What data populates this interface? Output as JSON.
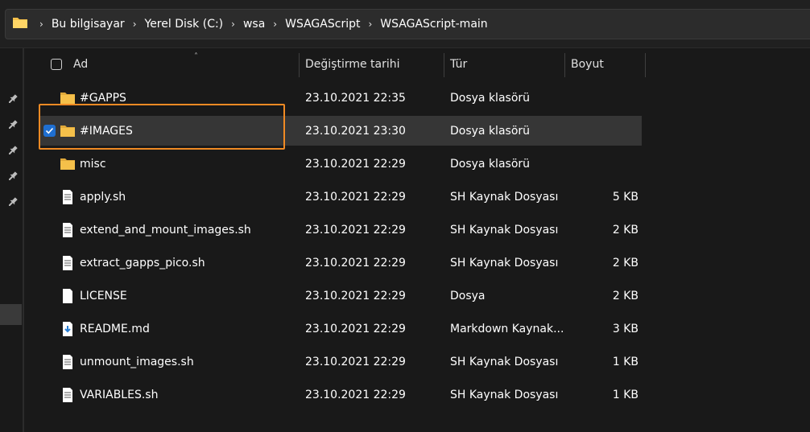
{
  "addressbar": {
    "breadcrumbs": [
      "Bu bilgisayar",
      "Yerel Disk (C:)",
      "wsa",
      "WSAGAScript",
      "WSAGAScript-main"
    ]
  },
  "columns": {
    "name": "Ad",
    "date": "Değiştirme tarihi",
    "type": "Tür",
    "size": "Boyut"
  },
  "files": [
    {
      "name": "#GAPPS",
      "date": "23.10.2021 22:35",
      "type": "Dosya klasörü",
      "size": "",
      "icon": "folder-icon"
    },
    {
      "name": "#IMAGES",
      "date": "23.10.2021 23:30",
      "type": "Dosya klasörü",
      "size": "",
      "icon": "folder-icon",
      "selected": true
    },
    {
      "name": "misc",
      "date": "23.10.2021 22:29",
      "type": "Dosya klasörü",
      "size": "",
      "icon": "folder-icon"
    },
    {
      "name": "apply.sh",
      "date": "23.10.2021 22:29",
      "type": "SH Kaynak Dosyası",
      "size": "5 KB",
      "icon": "text-file-icon"
    },
    {
      "name": "extend_and_mount_images.sh",
      "date": "23.10.2021 22:29",
      "type": "SH Kaynak Dosyası",
      "size": "2 KB",
      "icon": "text-file-icon"
    },
    {
      "name": "extract_gapps_pico.sh",
      "date": "23.10.2021 22:29",
      "type": "SH Kaynak Dosyası",
      "size": "2 KB",
      "icon": "text-file-icon"
    },
    {
      "name": "LICENSE",
      "date": "23.10.2021 22:29",
      "type": "Dosya",
      "size": "2 KB",
      "icon": "blank-file-icon"
    },
    {
      "name": "README.md",
      "date": "23.10.2021 22:29",
      "type": "Markdown Kaynak...",
      "size": "3 KB",
      "icon": "markdown-file-icon"
    },
    {
      "name": "unmount_images.sh",
      "date": "23.10.2021 22:29",
      "type": "SH Kaynak Dosyası",
      "size": "1 KB",
      "icon": "text-file-icon"
    },
    {
      "name": "VARIABLES.sh",
      "date": "23.10.2021 22:29",
      "type": "SH Kaynak Dosyası",
      "size": "1 KB",
      "icon": "text-file-icon"
    }
  ],
  "colors": {
    "background": "#191919",
    "selection": "#363636",
    "highlight": "#f08a24",
    "checkbox": "#1f6fd1",
    "folder": "#f5c04a"
  }
}
